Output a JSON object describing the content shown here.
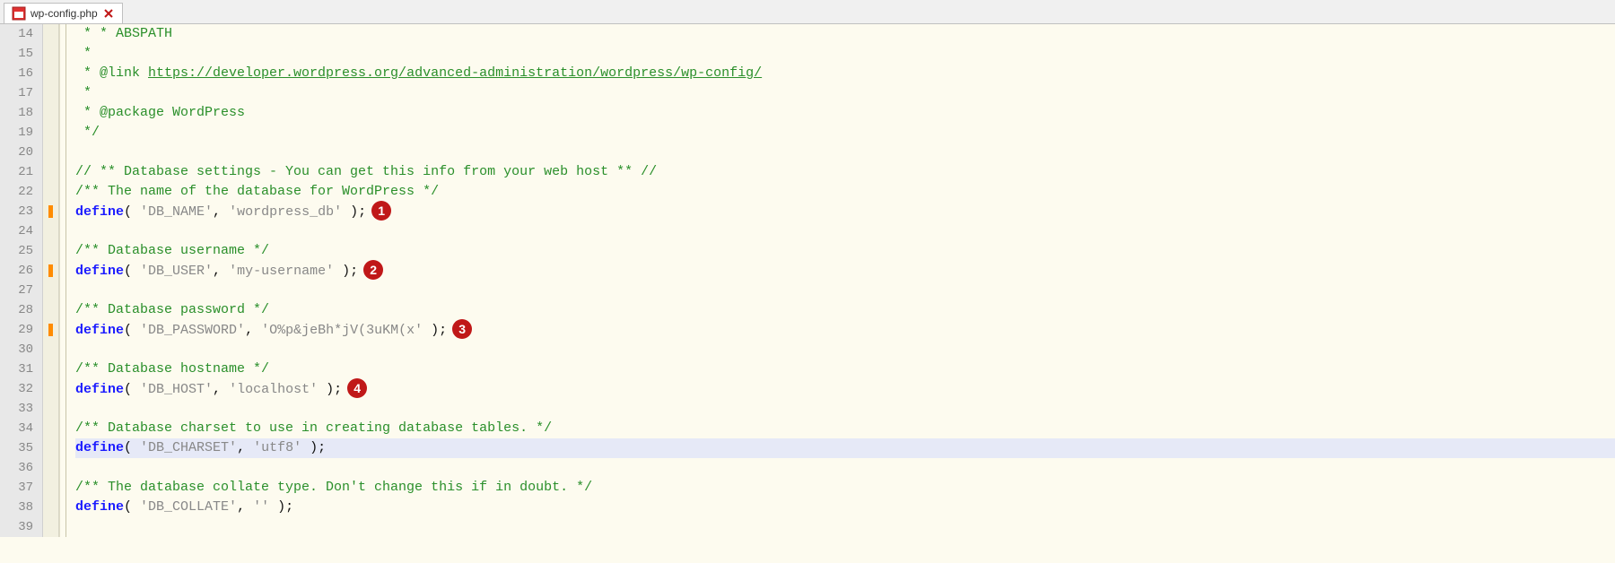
{
  "tab": {
    "filename": "wp-config.php"
  },
  "annotations": {
    "a1": "1",
    "a2": "2",
    "a3": "3",
    "a4": "4"
  },
  "gutter": [
    "14",
    "15",
    "16",
    "17",
    "18",
    "19",
    "20",
    "21",
    "22",
    "23",
    "24",
    "25",
    "26",
    "27",
    "28",
    "29",
    "30",
    "31",
    "32",
    "33",
    "34",
    "35",
    "36",
    "37",
    "38",
    "39"
  ],
  "code": {
    "l14": " * * ABSPATH",
    "l15": " *",
    "l16a": " * @link ",
    "l16b": "https://developer.wordpress.org/advanced-administration/wordpress/wp-config/",
    "l17": " *",
    "l18": " * @package WordPress",
    "l19": " */",
    "l21": "// ** Database settings - You can get this info from your web host ** //",
    "l22": "/** The name of the database for WordPress */",
    "l23_kw": "define",
    "l23_p1": "( ",
    "l23_s1": "'DB_NAME'",
    "l23_c": ", ",
    "l23_s2": "'wordpress_db'",
    "l23_p2": " );",
    "l25": "/** Database username */",
    "l26_kw": "define",
    "l26_p1": "( ",
    "l26_s1": "'DB_USER'",
    "l26_c": ", ",
    "l26_s2": "'my-username'",
    "l26_p2": " );",
    "l28": "/** Database password */",
    "l29_kw": "define",
    "l29_p1": "( ",
    "l29_s1": "'DB_PASSWORD'",
    "l29_c": ", ",
    "l29_s2": "'O%p&jeBh*jV(3uKM(x'",
    "l29_p2": " );",
    "l31": "/** Database hostname */",
    "l32_kw": "define",
    "l32_p1": "( ",
    "l32_s1": "'DB_HOST'",
    "l32_c": ", ",
    "l32_s2": "'localhost'",
    "l32_p2": " );",
    "l34": "/** Database charset to use in creating database tables. */",
    "l35_kw": "define",
    "l35_p1": "( ",
    "l35_s1": "'DB_CHARSET'",
    "l35_c": ", ",
    "l35_s2": "'utf8'",
    "l35_p2": " );",
    "l37": "/** The database collate type. Don't change this if in doubt. */",
    "l38_kw": "define",
    "l38_p1": "( ",
    "l38_s1": "'DB_COLLATE'",
    "l38_c": ", ",
    "l38_s2": "''",
    "l38_p2": " );"
  }
}
